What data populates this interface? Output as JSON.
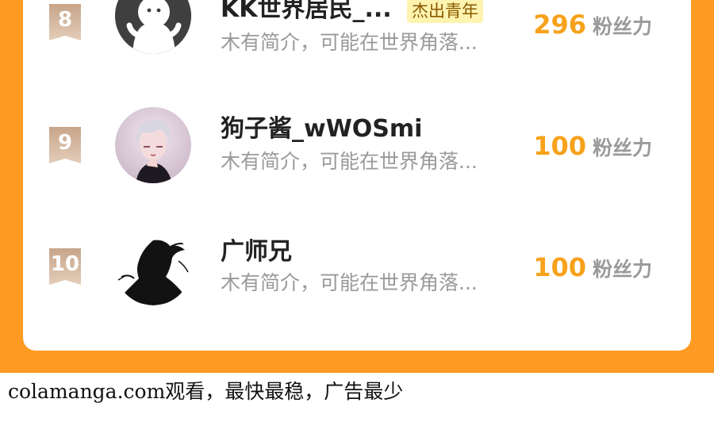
{
  "ranking": [
    {
      "rank": "8",
      "name": "KK世界居民_...",
      "title_badge": "杰出青年",
      "bio": "木有简介，可能在世界角落...",
      "fans_value": "296",
      "fans_label": "粉丝力",
      "avatar": "ghost-avatar-icon"
    },
    {
      "rank": "9",
      "name": "狗子酱_wWOSmi",
      "bio": "木有简介，可能在世界角落...",
      "fans_value": "100",
      "fans_label": "粉丝力",
      "avatar": "anime-portrait-avatar"
    },
    {
      "rank": "10",
      "name": "广师兄",
      "bio": "木有简介，可能在世界角落...",
      "fans_value": "100",
      "fans_label": "粉丝力",
      "avatar": "ink-silhouette-avatar"
    }
  ],
  "watermark": "colamanga.com观看，最快最稳，广告最少",
  "colors": {
    "frame": "#ff9b22",
    "fans_number": "#f7a21b",
    "rank_badge": "#c9a98c",
    "title_badge_bg": "#fff3b0"
  }
}
